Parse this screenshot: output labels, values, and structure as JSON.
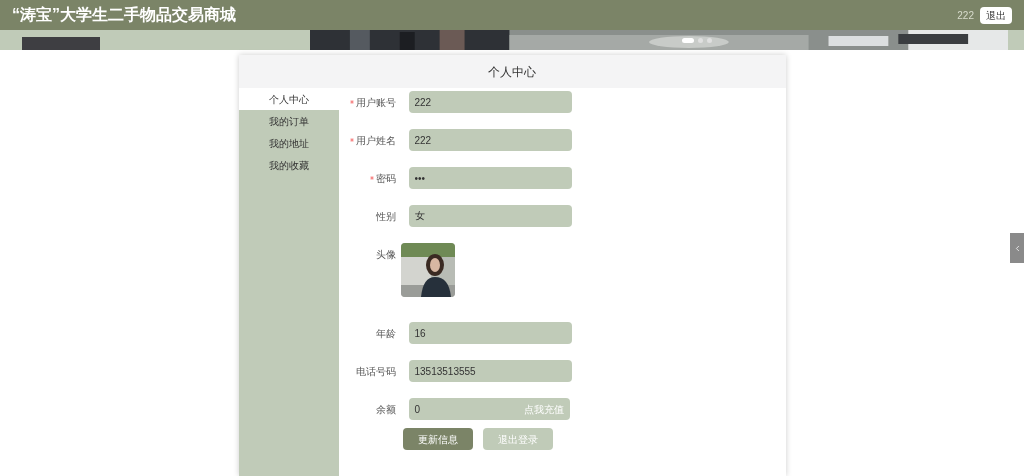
{
  "header": {
    "title": "“涛宝”大学生二手物品交易商城",
    "username": "222",
    "logout": "退出"
  },
  "banner": {
    "kind": "picture",
    "dots": [
      {
        "selected": true
      },
      {
        "selected": false
      },
      {
        "selected": false
      }
    ]
  },
  "panel": {
    "title": "个人中心"
  },
  "sidebar": {
    "items": [
      {
        "label": "个人中心",
        "selected": true
      },
      {
        "label": "我的订单",
        "selected": false
      },
      {
        "label": "我的地址",
        "selected": false
      },
      {
        "label": "我的收藏",
        "selected": false
      }
    ]
  },
  "form": {
    "fields": [
      {
        "kind": "text",
        "label": "用户账号",
        "required": true,
        "value": "222"
      },
      {
        "kind": "text",
        "label": "用户姓名",
        "required": true,
        "value": "222"
      },
      {
        "kind": "text",
        "label": "密码",
        "required": true,
        "value": "•••"
      },
      {
        "kind": "text",
        "label": "性别",
        "required": false,
        "value": "女"
      },
      {
        "label": "头像",
        "required": false
      },
      {
        "kind": "text",
        "label": "年龄",
        "required": false,
        "value": "16"
      },
      {
        "kind": "text",
        "label": "电话号码",
        "required": false,
        "value": "13513513555"
      },
      {
        "kind": "balance",
        "label": "余额",
        "required": false,
        "value": "0",
        "action": "点我充值"
      }
    ],
    "buttons": [
      {
        "label": "更新信息",
        "kind": "primary"
      },
      {
        "label": "退出登录",
        "kind": "secondary"
      }
    ]
  }
}
